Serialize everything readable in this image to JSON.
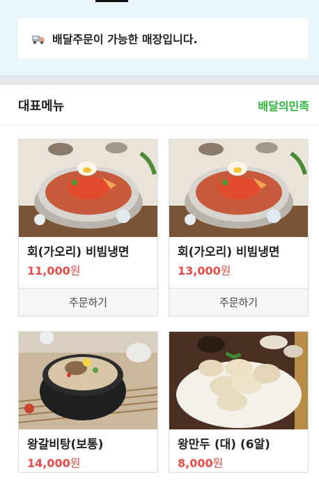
{
  "notice": {
    "icon": "delivery-truck-icon",
    "text": "배달주문이 가능한 매장입니다."
  },
  "section": {
    "title": "대표메뉴",
    "brand": "배달의민족"
  },
  "menu": [
    {
      "name": "회(가오리) 비빔냉면",
      "price": "11,000",
      "unit": "원",
      "order_label": "주문하기"
    },
    {
      "name": "회(가오리) 비빔냉면",
      "price": "13,000",
      "unit": "원",
      "order_label": "주문하기"
    },
    {
      "name": "왕갈비탕(보통)",
      "price": "14,000",
      "unit": "원"
    },
    {
      "name": "왕만두 (대) (6알)",
      "price": "8,000",
      "unit": "원"
    }
  ],
  "colors": {
    "brand_green": "#2bb33a",
    "price_red": "#e64b46",
    "top_bg": "#e8f5fb"
  }
}
